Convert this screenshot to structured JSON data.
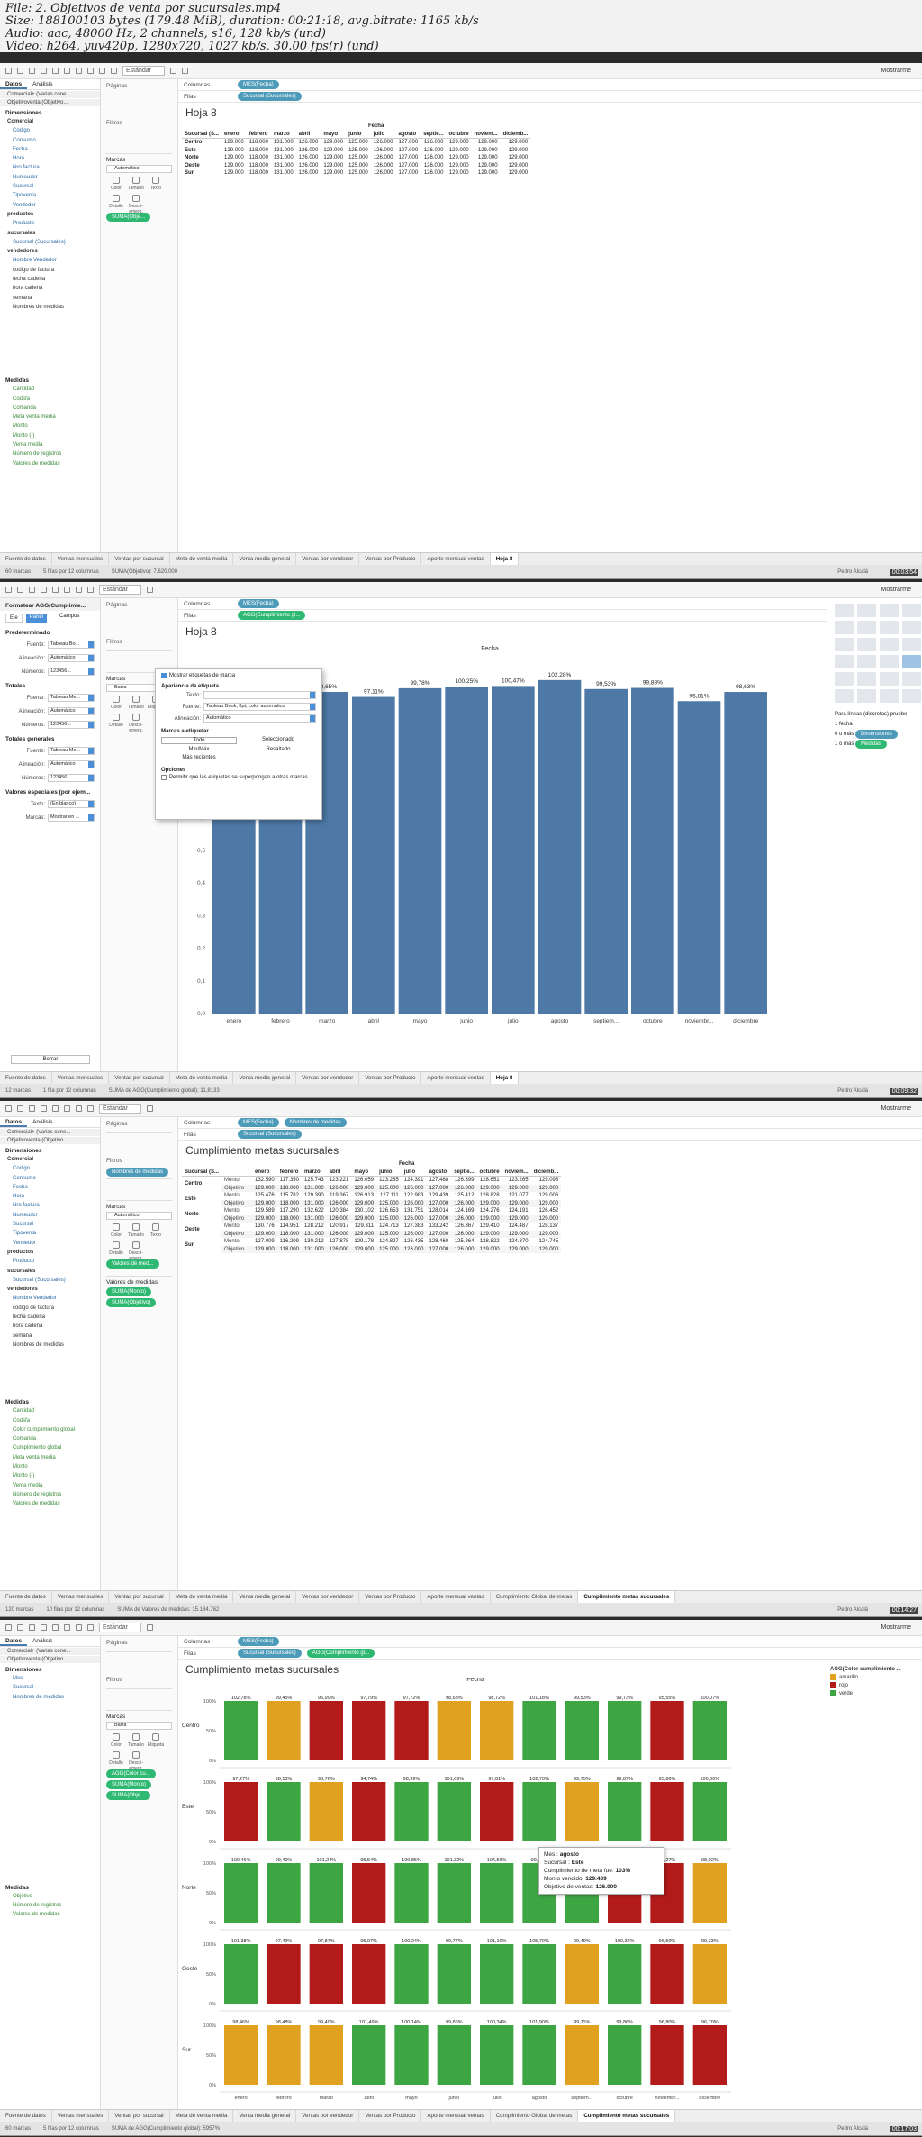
{
  "header": {
    "line1": "File: 2. Objetivos de venta por sucursales.mp4",
    "line2": "Size: 188100103 bytes (179.48 MiB), duration: 00:21:18, avg.bitrate: 1165 kb/s",
    "line3": "Audio: aac, 48000 Hz, 2 channels, s16, 128 kb/s (und)",
    "line4": "Video: h264, yuv420p, 1280x720, 1027 kb/s, 30.00 fps(r) (und)"
  },
  "common": {
    "toolbar_dropdown": "Estándar",
    "showme": "Mostrarme",
    "datos": "Datos",
    "analisis": "Análisis",
    "paginas": "Páginas",
    "filtros": "Filtros",
    "marcas": "Marcas",
    "columnas": "Columnas",
    "filas": "Filas",
    "automatico": "Automático",
    "barra": "Barra",
    "color": "Color",
    "tamano": "Tamaño",
    "texto": "Texto",
    "detalle": "Detalle",
    "descripcion": "Descri-emerg.",
    "etiqueta": "Etiqueta",
    "user": "Pedro Alcalá",
    "dimensiones": "Dimensiones",
    "medidas": "Medidas",
    "datasource1": "Comercial+ (Varias cone...",
    "datasource2": "Objetivoventa (Objetivo...",
    "fecha_header": "Fecha"
  },
  "months": [
    "enero",
    "febrero",
    "marzo",
    "abril",
    "mayo",
    "junio",
    "julio",
    "agosto",
    "septie...",
    "octubre",
    "noviem...",
    "diciemb..."
  ],
  "months_full": [
    "enero",
    "febrero",
    "marzo",
    "abril",
    "mayo",
    "junio",
    "julio",
    "agosto",
    "septiembre",
    "octubre",
    "noviembre",
    "diciembre"
  ],
  "months_b2": [
    "enero",
    "febrero",
    "marzo",
    "abril",
    "mayo",
    "junio",
    "julio",
    "agosto",
    "septiem...",
    "octubre",
    "noviembr...",
    "diciembre"
  ],
  "dims_full": [
    {
      "t": "Comercial",
      "g": 1
    },
    {
      "t": "Codigo"
    },
    {
      "t": "Consumo"
    },
    {
      "t": "Fecha"
    },
    {
      "t": "Hora"
    },
    {
      "t": "Nro factura"
    },
    {
      "t": "Numeudcr"
    },
    {
      "t": "Sucursal"
    },
    {
      "t": "Tipoventa"
    },
    {
      "t": "Vendedor"
    },
    {
      "t": "productos",
      "g": 1
    },
    {
      "t": "Producto"
    },
    {
      "t": "sucursales",
      "g": 1
    },
    {
      "t": "Sucursal (Sucursales)"
    },
    {
      "t": "vendedores",
      "g": 1
    },
    {
      "t": "Nombre Vendedor"
    },
    {
      "t": "codigo de factura",
      "s": 1
    },
    {
      "t": "fecha cadena",
      "s": 1
    },
    {
      "t": "hora cadena",
      "s": 1
    },
    {
      "t": "semana",
      "s": 1
    },
    {
      "t": "Nombres de medidas",
      "s": 1
    }
  ],
  "measures1": [
    "Cantidad",
    "Codsfa",
    "Comanda",
    "Meta venta media",
    "Monto",
    "Monto (-)",
    "Venta media",
    "Número de registros",
    "Valores de medidas"
  ],
  "measures3": [
    "Cantidad",
    "Codsfa",
    "Color cumplimiento global",
    "Comanda",
    "Cumplimiento global",
    "Meta venta media",
    "Monto",
    "Monto (-)",
    "Venta media",
    "Número de registros",
    "Valores de medidas"
  ],
  "tabs1": [
    "Fuente de datos",
    "Ventas mensuales",
    "Ventas por sucursal",
    "Meta de venta media",
    "Venta media general",
    "Ventas por vendedor",
    "Ventas por Producto",
    "Aporte mensual ventas",
    "Hoja 8"
  ],
  "tabs3": [
    "Fuente de datos",
    "Ventas mensuales",
    "Ventas por sucursal",
    "Meta de venta media",
    "Venta media general",
    "Ventas por vendedor",
    "Ventas por Producto",
    "Aporte mensual ventas",
    "Cumplimiento Global de metas",
    "Cumplimiento metas sucursales"
  ],
  "shot1": {
    "cols_pill": "MES(Fecha)",
    "rows_pill": "Sucursal (Sucursales)",
    "title": "Hoja 8",
    "marks_type": "Automático",
    "marks_pill": "SUMA(Obje...",
    "row_header": "Sucursal (S...",
    "rows": [
      {
        "n": "Centro",
        "v": [
          "129.000",
          "118.000",
          "131.000",
          "126.000",
          "129.000",
          "125.000",
          "126.000",
          "127.000",
          "126.000",
          "129.000",
          "129.000",
          "129.000"
        ]
      },
      {
        "n": "Este",
        "v": [
          "129.000",
          "118.000",
          "131.000",
          "126.000",
          "129.000",
          "125.000",
          "126.000",
          "127.000",
          "126.000",
          "129.000",
          "129.000",
          "129.000"
        ]
      },
      {
        "n": "Norte",
        "v": [
          "129.000",
          "118.000",
          "131.000",
          "126.000",
          "129.000",
          "125.000",
          "126.000",
          "127.000",
          "126.000",
          "129.000",
          "129.000",
          "129.000"
        ]
      },
      {
        "n": "Oeste",
        "v": [
          "129.000",
          "118.000",
          "131.000",
          "126.000",
          "129.000",
          "125.000",
          "126.000",
          "127.000",
          "126.000",
          "129.000",
          "129.000",
          "129.000"
        ]
      },
      {
        "n": "Sur",
        "v": [
          "129.000",
          "118.000",
          "131.000",
          "126.000",
          "129.000",
          "125.000",
          "126.000",
          "127.000",
          "126.000",
          "129.000",
          "129.000",
          "129.000"
        ]
      }
    ],
    "status": [
      "60 marcas",
      "5 filas por 12 columnas",
      "SUMA(Objetivo): 7.620.000"
    ],
    "timestamp": "00:03:54"
  },
  "shot2": {
    "format_title": "Formatear AGG(Cumplimie...",
    "eje": "Eje",
    "panel": "Panel",
    "campos": "Campos",
    "sections": [
      {
        "h": "Predeterminado",
        "rows": [
          [
            "Fuente:",
            "Tableau Bo..."
          ],
          [
            "Alineación:",
            "Automático"
          ],
          [
            "Números:",
            "123456..."
          ]
        ]
      },
      {
        "h": "Totales",
        "rows": [
          [
            "Fuente:",
            "Tableau Me..."
          ],
          [
            "Alineación:",
            "Automático"
          ],
          [
            "Números:",
            "123456..."
          ]
        ]
      },
      {
        "h": "Totales generales",
        "rows": [
          [
            "Fuente:",
            "Tableau Me..."
          ],
          [
            "Alineación:",
            "Automático"
          ],
          [
            "Números:",
            "123456..."
          ]
        ]
      },
      {
        "h": "Valores especiales (por ejem...",
        "rows": [
          [
            "Texto:",
            "(En blanco)"
          ],
          [
            "Marcas:",
            "Mostrar en ..."
          ]
        ]
      }
    ],
    "borrar": "Borrar",
    "cols_pill": "MES(Fecha)",
    "rows_pill": "AGG(Cumplimiento gl...",
    "title": "Hoja 8",
    "marks_type": "Barra",
    "popup": {
      "check": "Mostrar etiquetas de marca",
      "aparencia": "Apariencia de etiqueta",
      "texto": "Texto:",
      "fuente": "Fuente:",
      "fuente_v": "Tableau Book, 8pt, color automático",
      "alineacion": "Alineación:",
      "alineacion_v": "Automático",
      "marcas_etiq": "Marcas a etiquetar",
      "opts": [
        "Todo",
        "Seleccionado",
        "Mín/Máx",
        "Resaltado",
        "Más recientes"
      ],
      "opciones": "Opciones",
      "permitir": "Permitir que las etiquetas se superpongan a otras marcas"
    },
    "showme_text": [
      "Para líneas (discretas) pruebe",
      "1 fecha",
      "0 o más",
      "Dimensiones",
      "1 o más",
      "Medidas"
    ],
    "status": [
      "12 marcas",
      "1 fila por 12 columnas",
      "SUMA de AGG(Cumplimiento global): 11,8133"
    ],
    "timestamp": "00:09:32"
  },
  "shot3": {
    "cols_pill": "MES(Fecha)",
    "cols_pill2": "Nombres de medidas",
    "rows_pill": "Sucursal (Sucursales)",
    "filter_pill": "Nombres de medidas",
    "title": "Cumplimiento metas sucursales",
    "marks_pill": "Valores de med...",
    "valores_label": "Valores de medidas",
    "val_pills": [
      "SUMA(Monto)",
      "SUMA(Objetivo)"
    ],
    "row_header": "Sucursal (S...",
    "monto": "Monto",
    "objetivo": "Objetivo",
    "rows": [
      {
        "n": "Centro",
        "m": [
          "132.590",
          "117.350",
          "125.743",
          "123.221",
          "126.059",
          "123.285",
          "124.391",
          "127.488",
          "126.399",
          "128.651",
          "123.265",
          "129.096"
        ],
        "o": [
          "129.000",
          "118.000",
          "131.000",
          "126.000",
          "129.000",
          "125.000",
          "126.000",
          "127.000",
          "126.000",
          "129.000",
          "129.000",
          "129.000"
        ]
      },
      {
        "n": "Este",
        "m": [
          "125.476",
          "115.782",
          "129.390",
          "119.367",
          "126.913",
          "127.111",
          "122.983",
          "129.439",
          "125.412",
          "128.828",
          "121.077",
          "129.006"
        ],
        "o": [
          "129.000",
          "118.000",
          "131.000",
          "126.000",
          "129.000",
          "125.000",
          "126.000",
          "127.000",
          "126.000",
          "129.000",
          "129.000",
          "129.000"
        ]
      },
      {
        "n": "Norte",
        "m": [
          "129.589",
          "117.290",
          "132.622",
          "120.384",
          "130.102",
          "126.653",
          "131.751",
          "128.014",
          "124.169",
          "124.276",
          "124.191",
          "126.452"
        ],
        "o": [
          "129.000",
          "118.000",
          "131.000",
          "126.000",
          "129.000",
          "125.000",
          "126.000",
          "127.000",
          "126.000",
          "129.000",
          "129.000",
          "129.000"
        ]
      },
      {
        "n": "Oeste",
        "m": [
          "130.776",
          "114.951",
          "128.212",
          "120.917",
          "129.311",
          "124.713",
          "127.383",
          "133.242",
          "126.367",
          "129.410",
          "124.487",
          "128.137"
        ],
        "o": [
          "129.000",
          "118.000",
          "131.000",
          "126.000",
          "129.000",
          "125.000",
          "126.000",
          "127.000",
          "126.000",
          "129.000",
          "129.000",
          "129.000"
        ]
      },
      {
        "n": "Sur",
        "m": [
          "127.009",
          "116.209",
          "130.212",
          "127.878",
          "129.178",
          "124.827",
          "126.435",
          "128.460",
          "125.864",
          "128.822",
          "124.870",
          "124.745"
        ],
        "o": [
          "129.000",
          "118.000",
          "131.000",
          "126.000",
          "129.000",
          "125.000",
          "126.000",
          "127.000",
          "126.000",
          "129.000",
          "129.000",
          "129.000"
        ]
      }
    ],
    "status": [
      "120 marcas",
      "10 filas por 12 columnas",
      "SUMA de Valores de medidas: 15.184.762"
    ],
    "timestamp": "00:14:27"
  },
  "shot4": {
    "cols_pill": "MES(Fecha)",
    "rows_pill1": "Sucursal (Sucursales)",
    "rows_pill2": "AGG(Cumplimiento gl...",
    "title": "Cumplimiento metas sucursales",
    "dims": [
      "Mes",
      "Sucursal",
      "Nombres de medidas"
    ],
    "measures": [
      "Objetivo",
      "Número de registros",
      "Valores de medidas"
    ],
    "marks_type": "Barra",
    "mark_pills": [
      "AGG(Color cu...",
      "SUMA(Monto)",
      "SUMA(Obje..."
    ],
    "yticks": [
      "100%",
      "50%",
      "0%"
    ],
    "legend_title": "AGG(Color cumplimiento ...",
    "legend": [
      {
        "n": "amarillo",
        "c": "#e0a020"
      },
      {
        "n": "rojo",
        "c": "#b31b1b"
      },
      {
        "n": "verde",
        "c": "#3ea543"
      }
    ],
    "colors": {
      "amarillo": "#e0a020",
      "rojo": "#b31b1b",
      "verde": "#3ea543"
    },
    "rows": [
      {
        "n": "Centro",
        "p": [
          "102,78%",
          "99,45%",
          "95,99%",
          "97,79%",
          "97,72%",
          "98,63%",
          "98,72%",
          "101,18%",
          "99,53%",
          "99,73%",
          "95,55%",
          "100,07%"
        ],
        "c": [
          "verde",
          "amarillo",
          "rojo",
          "rojo",
          "rojo",
          "amarillo",
          "amarillo",
          "verde",
          "verde",
          "verde",
          "rojo",
          "verde"
        ]
      },
      {
        "n": "Este",
        "p": [
          "97,27%",
          "98,13%",
          "98,76%",
          "94,74%",
          "98,39%",
          "101,69%",
          "97,61%",
          "102,73%",
          "99,75%",
          "99,87%",
          "93,86%",
          "100,00%"
        ],
        "c": [
          "rojo",
          "verde",
          "amarillo",
          "rojo",
          "verde",
          "verde",
          "rojo",
          "verde",
          "amarillo",
          "verde",
          "rojo",
          "verde"
        ]
      },
      {
        "n": "Norte",
        "p": [
          "100,46%",
          "99,40%",
          "101,24%",
          "95,54%",
          "100,85%",
          "101,32%",
          "104,56%",
          "99,77%",
          "",
          "96,33%",
          "96,27%",
          "98,02%"
        ],
        "c": [
          "verde",
          "verde",
          "verde",
          "rojo",
          "verde",
          "verde",
          "verde",
          "verde",
          "verde",
          "rojo",
          "rojo",
          "amarillo"
        ]
      },
      {
        "n": "Oeste",
        "p": [
          "101,38%",
          "97,42%",
          "97,87%",
          "95,97%",
          "100,24%",
          "99,77%",
          "101,10%",
          "105,70%",
          "99,49%",
          "100,32%",
          "96,50%",
          "99,33%"
        ],
        "c": [
          "verde",
          "rojo",
          "rojo",
          "rojo",
          "verde",
          "verde",
          "verde",
          "verde",
          "amarillo",
          "verde",
          "rojo",
          "amarillo"
        ]
      },
      {
        "n": "Sur",
        "p": [
          "98,46%",
          "98,48%",
          "99,40%",
          "101,49%",
          "100,14%",
          "99,86%",
          "100,34%",
          "101,90%",
          "99,11%",
          "99,86%",
          "96,80%",
          "96,70%"
        ],
        "c": [
          "amarillo",
          "amarillo",
          "amarillo",
          "verde",
          "verde",
          "verde",
          "verde",
          "verde",
          "amarillo",
          "verde",
          "rojo",
          "rojo"
        ]
      }
    ],
    "tooltip": [
      [
        "Mes :",
        "agosto"
      ],
      [
        "Sucursal :",
        "Este"
      ],
      [
        "Cumplimiento de meta fue:",
        "103%"
      ],
      [
        "Monto vendido:",
        "129.439"
      ],
      [
        "Objetivo de ventas:",
        "126.000"
      ]
    ],
    "status": [
      "60 marcas",
      "5 filas por 12 columnas",
      "SUMA de AGG(Cumplimiento global): 5957%"
    ],
    "timestamp": "00:17:03"
  },
  "chart_data": {
    "type": "bar",
    "title": "Hoja 8",
    "xlabel": "Fecha",
    "categories": [
      "enero",
      "febrero",
      "marzo",
      "abril",
      "mayo",
      "junio",
      "julio",
      "agosto",
      "septiembre",
      "octubre",
      "noviembre",
      "diciembre"
    ],
    "values": [
      100.07,
      98.59,
      98.65,
      97.11,
      99.78,
      100.25,
      100.47,
      102.28,
      99.53,
      99.88,
      95.81,
      98.63
    ],
    "labels": [
      "100,07%",
      "98,59%",
      "98,65%",
      "97,11%",
      "99,78%",
      "100,25%",
      "100,47%",
      "102,28%",
      "99,53%",
      "99,88%",
      "95,81%",
      "98,63%"
    ],
    "yticks": [
      "0,0",
      "0,1",
      "0,2",
      "0,3",
      "0,4",
      "0,5",
      "0,6",
      "0,7",
      "0,8",
      "0,9",
      "1,0"
    ],
    "ylim": [
      0,
      1.05
    ],
    "color": "#4e79a7"
  }
}
